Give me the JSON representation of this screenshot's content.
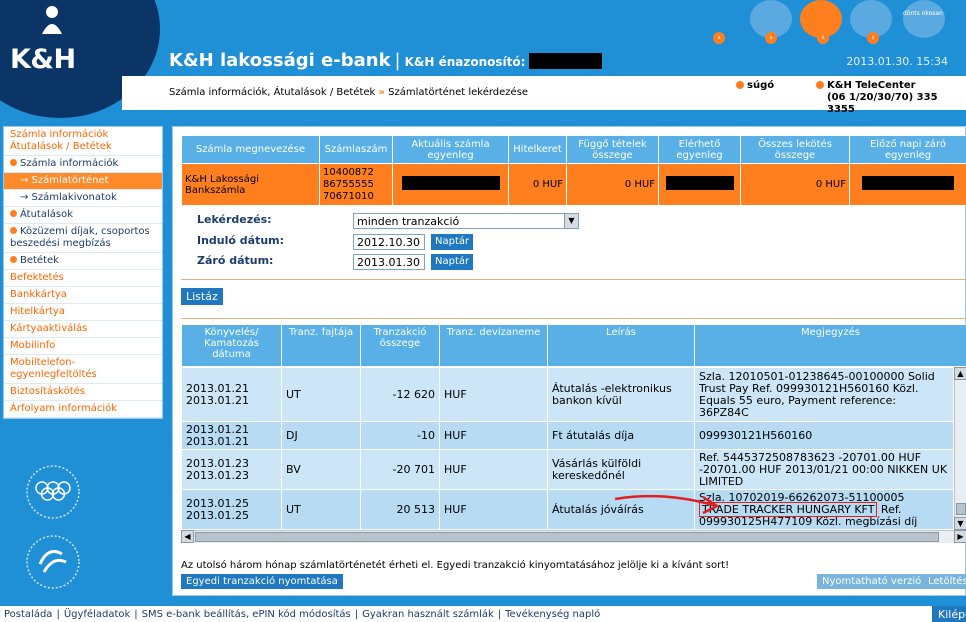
{
  "header": {
    "logo": "K&H",
    "title": "K&H lakossági e-bank",
    "id_label": "K&H énazonosító:",
    "datetime": "2013.01.30. 15:34",
    "nav_tag": "dönts okosan",
    "breadcrumb": [
      "Számla információk, Átutalások / Betétek",
      "Számlatörténet lekérdezése"
    ],
    "help": "súgó",
    "telecenter_title": "K&H TeleCenter",
    "telecenter_phone": "(06 1/20/30/70) 335 3355"
  },
  "menu": [
    {
      "label": "Számla információk Átutalások / Betétek",
      "style": "top"
    },
    {
      "label": "Számla információk",
      "style": "lvl1"
    },
    {
      "label": "→ Számlatörténet",
      "style": "active"
    },
    {
      "label": "→ Számlakivonatok",
      "style": "sub"
    },
    {
      "label": "Átutalások",
      "style": "lvl1"
    },
    {
      "label": "Közüzemi díjak, csoportos beszedési megbízás",
      "style": "lvl1"
    },
    {
      "label": "Betétek",
      "style": "lvl1"
    },
    {
      "label": "Befektetés",
      "style": "top"
    },
    {
      "label": "Bankkártya",
      "style": "top"
    },
    {
      "label": "Hitelkártya",
      "style": "top"
    },
    {
      "label": "Kártyaaktiválás",
      "style": "top"
    },
    {
      "label": "Mobilinfo",
      "style": "top"
    },
    {
      "label": "Mobiltelefon-egyenlegfeltöltés",
      "style": "top"
    },
    {
      "label": "Biztosításkötés",
      "style": "top"
    },
    {
      "label": "Árfolyam információk",
      "style": "top"
    }
  ],
  "account": {
    "headers": [
      "Számla megnevezése",
      "Számlaszám",
      "Aktuális számla egyenleg",
      "Hitelkeret",
      "Függő tételek összege",
      "Elérhető egyenleg",
      "Összes lekötés összege",
      "Előző napi záró egyenleg"
    ],
    "name": "K&H Lakossági Bankszámla",
    "number": [
      "10400872",
      "86755555",
      "70671010"
    ],
    "credit": "0 HUF",
    "pending": "0 HUF",
    "locked": "0 HUF"
  },
  "query": {
    "type_label": "Lekérdezés:",
    "type_value": "minden tranzakció",
    "start_label": "Induló dátum:",
    "start_value": "2012.10.30",
    "end_label": "Záró dátum:",
    "end_value": "2013.01.30",
    "calendar": "Naptár",
    "list_button": "Listáz"
  },
  "transactions": {
    "headers": [
      "Könyvelés/ Kamatozás dátuma",
      "Tranz. fajtája",
      "Tranzakció összege",
      "Tranz. devizaneme",
      "Leírás",
      "Megjegyzés"
    ],
    "rows": [
      {
        "date1": "2013.01.21",
        "date2": "2013.01.21",
        "type": "UT",
        "amount": "-12 620",
        "currency": "HUF",
        "desc": "Átutalás -elektronikus bankon kívül",
        "note": "Szla. 12010501-01238645-00100000 Solid Trust Pay Ref. 099930121H560160 Közl. Equals 55 euro, Payment reference: 36PZ84C"
      },
      {
        "date1": "2013.01.21",
        "date2": "2013.01.21",
        "type": "DJ",
        "amount": "-10",
        "currency": "HUF",
        "desc": "Ft átutalás díja",
        "note": "099930121H560160"
      },
      {
        "date1": "2013.01.23",
        "date2": "2013.01.23",
        "type": "BV",
        "amount": "-20 701",
        "currency": "HUF",
        "desc": "Vásárlás külföldi kereskedőnél",
        "note": "Ref. 5445372508783623 -20701.00 HUF -20701.00 HUF 2013/01/21 00:00 NIKKEN UK LIMITED"
      },
      {
        "date1": "2013.01.25",
        "date2": "2013.01.25",
        "type": "UT",
        "amount": "20 513",
        "currency": "HUF",
        "desc": "Átutalás jóváírás",
        "note_pre": "Szla. 10702019-66262073-51100005",
        "note_highlight": "TRADE TRACKER HUNGARY KFT",
        "note_post": "Ref. 099930125H477109 Közl. megbízási díj"
      }
    ]
  },
  "bottom": {
    "note": "Az utolsó három hónap számlatörténetét érheti el.  Egyedi tranzakció kinyomtatásához jelölje ki a kívánt sort!",
    "print_single": "Egyedi tranzakció nyomtatása",
    "print_version": "Nyomtatható verzió",
    "download": "Letöltés"
  },
  "footer": {
    "links": [
      "Postaláda",
      "Ügyféladatok",
      "SMS e-bank beállítás, ePIN kód módosítás",
      "Gyakran használt számlák",
      "Tevékenység napló"
    ],
    "logout": "Kilépés"
  },
  "colors": {
    "brand_blue": "#1f8fd6",
    "navy": "#0a3566",
    "orange": "#ff7f1e",
    "header_cell": "#58b0e7",
    "row_bg": "#cce6f7"
  }
}
